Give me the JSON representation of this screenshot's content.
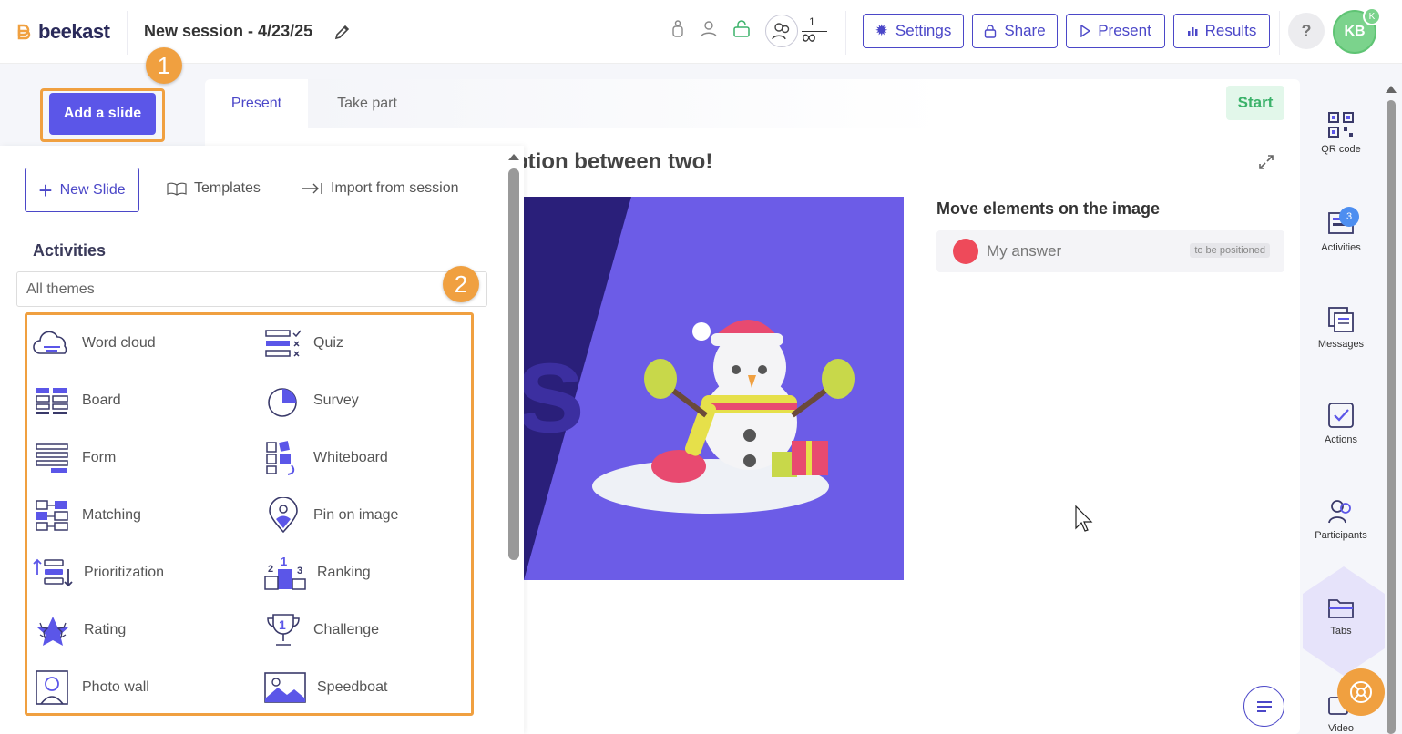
{
  "header": {
    "logo_text": "beekast",
    "session_title": "New session - 4/23/25",
    "participants_count": "1",
    "participants_limit": "∞",
    "buttons": {
      "settings": "Settings",
      "share": "Share",
      "present": "Present",
      "results": "Results"
    },
    "help": "?",
    "avatar_initials": "KB",
    "avatar_badge": "K"
  },
  "steps": {
    "one": "1",
    "two": "2"
  },
  "add_slide_label": "Add a slide",
  "panel": {
    "new_slide": "New Slide",
    "templates": "Templates",
    "import": "Import from session",
    "activities_heading": "Activities",
    "theme_filter": "All themes",
    "activities": [
      {
        "label": "Word cloud",
        "icon": "word-cloud-icon"
      },
      {
        "label": "Quiz",
        "icon": "quiz-icon"
      },
      {
        "label": "Board",
        "icon": "board-icon"
      },
      {
        "label": "Survey",
        "icon": "survey-icon"
      },
      {
        "label": "Form",
        "icon": "form-icon"
      },
      {
        "label": "Whiteboard",
        "icon": "whiteboard-icon"
      },
      {
        "label": "Matching",
        "icon": "matching-icon"
      },
      {
        "label": "Pin on image",
        "icon": "pin-on-image-icon"
      },
      {
        "label": "Prioritization",
        "icon": "prioritization-icon"
      },
      {
        "label": "Ranking",
        "icon": "ranking-icon"
      },
      {
        "label": "Rating",
        "icon": "rating-icon"
      },
      {
        "label": "Challenge",
        "icon": "challenge-icon"
      },
      {
        "label": "Photo wall",
        "icon": "photo-wall-icon"
      },
      {
        "label": "Speedboat",
        "icon": "speedboat-icon"
      }
    ]
  },
  "main": {
    "tabs": {
      "present": "Present",
      "take_part": "Take part"
    },
    "start": "Start",
    "question_title": "ption between two!",
    "image_text": "s",
    "move_title": "Move elements on the image",
    "answer_label": "My answer",
    "answer_tag": "to be positioned"
  },
  "right_sidebar": {
    "qr": "QR code",
    "activities": "Activities",
    "activities_badge": "3",
    "messages": "Messages",
    "actions": "Actions",
    "participants": "Participants",
    "tabs": "Tabs",
    "video": "Video"
  },
  "colors": {
    "primary": "#5b56e8",
    "accent_orange": "#f0a040",
    "start_green": "#3bb26a",
    "answer_red": "#ee4a5a"
  }
}
